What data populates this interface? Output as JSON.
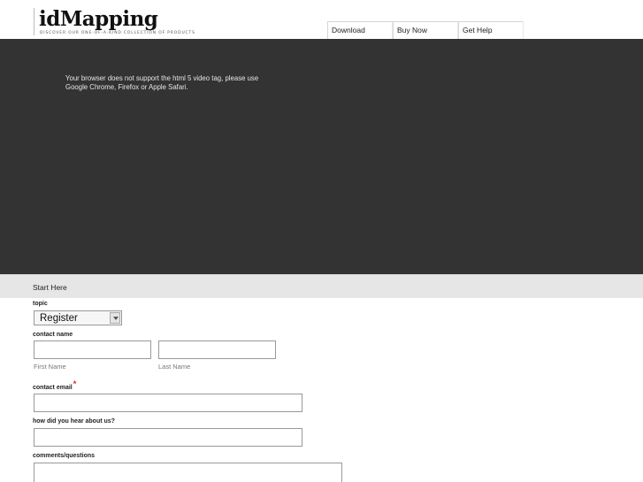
{
  "header": {
    "logo_title": "idMapping",
    "logo_tagline": "DISCOVER OUR ONE-OF-A-KIND COLLECTION OF PRODUCTS"
  },
  "nav": {
    "items": [
      {
        "label": "Download"
      },
      {
        "label": "Buy Now"
      },
      {
        "label": "Get Help"
      }
    ]
  },
  "video": {
    "fallback_message": "Your browser does not support the html 5 video tag, please use Google Chrome, Firefox or Apple Safari."
  },
  "form": {
    "section_title": "Start Here",
    "topic": {
      "label": "topic",
      "selected": "Register"
    },
    "contact_name": {
      "label": "contact name",
      "first_label": "First Name",
      "last_label": "Last Name"
    },
    "contact_email": {
      "label": "contact email",
      "required_mark": "*"
    },
    "heard_about": {
      "label": "how did you hear about us?"
    },
    "comments": {
      "label": "comments/questions"
    }
  },
  "colors": {
    "video_background": "#333333",
    "section_bar": "#e6e6e6",
    "required": "#dd2222"
  }
}
